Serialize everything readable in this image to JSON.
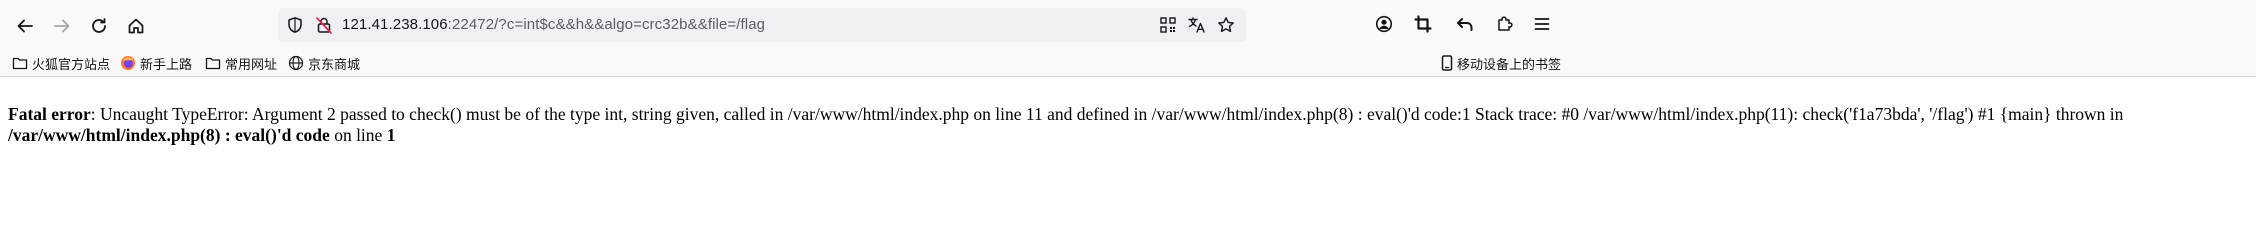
{
  "browser": {
    "back_icon": "arrow-left-icon",
    "forward_icon": "arrow-right-icon",
    "reload_icon": "reload-icon",
    "home_icon": "home-icon",
    "url": {
      "host": "121.41.238.106",
      "rest": ":22472/?c=int$c&&h&&algo=crc32b&&file=/flag"
    },
    "url_icons": [
      "shield-icon",
      "insecure-lock-icon"
    ],
    "url_right_icons": [
      "qr-code-icon",
      "translate-icon",
      "bookmark-star-icon"
    ],
    "toolbar_right_icons": [
      "account-icon",
      "screenshot-crop-icon",
      "undo-icon",
      "extensions-icon",
      "menu-icon"
    ]
  },
  "bookmarks": {
    "items": [
      {
        "label": "火狐官方站点",
        "icon": "folder-icon"
      },
      {
        "label": "新手上路",
        "icon": "firefox-icon"
      },
      {
        "label": "常用网址",
        "icon": "folder-icon"
      },
      {
        "label": "京东商城",
        "icon": "globe-icon"
      }
    ],
    "mobile": {
      "label": "移动设备上的书签",
      "icon": "mobile-icon"
    }
  },
  "error": {
    "heading": "Fatal error",
    "message_part1": ": Uncaught TypeError: Argument 2 passed to check() must be of the type int, string given, called in /var/www/html/index.php on line 11 and defined in /var/www/html/index.php(8) : eval()'d code:1 Stack trace: #0 /var/www/html/index.php(11): check('f1a73bda', '/flag') #1 {main} thrown in ",
    "location": "/var/www/html/index.php(8) : eval()'d code",
    "on_line_text": " on line ",
    "line_number": "1"
  }
}
